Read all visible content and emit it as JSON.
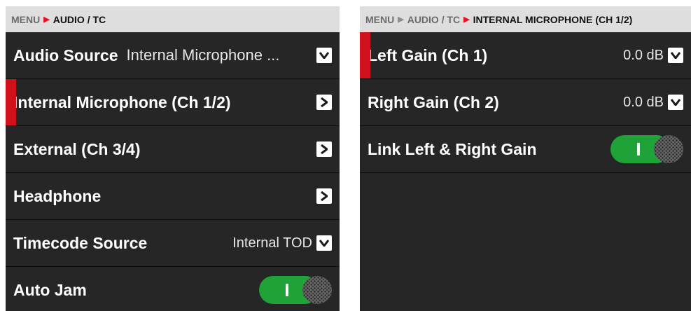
{
  "left_panel": {
    "breadcrumb": {
      "menu": "MENU",
      "current": "AUDIO / TC"
    },
    "rows": [
      {
        "label": "Audio Source",
        "value": "Internal Microphone ..."
      },
      {
        "label": "Internal Microphone (Ch 1/2)"
      },
      {
        "label": "External (Ch 3/4)"
      },
      {
        "label": "Headphone"
      },
      {
        "label": "Timecode Source",
        "value": "Internal TOD"
      },
      {
        "label": "Auto Jam",
        "toggle_on": true
      }
    ],
    "selected_row": "Internal Microphone (Ch 1/2)"
  },
  "right_panel": {
    "breadcrumb": {
      "menu": "MENU",
      "parent": "AUDIO / TC",
      "current": "INTERNAL MICROPHONE (CH 1/2)"
    },
    "rows": [
      {
        "label": "Left Gain (Ch 1)",
        "value": "0.0 dB"
      },
      {
        "label": "Right Gain (Ch 2)",
        "value": "0.0 dB"
      },
      {
        "label": "Link Left & Right Gain",
        "toggle_on": true
      }
    ],
    "selected_row": "Left Gain (Ch 1)"
  },
  "colors": {
    "panel_bg": "#262626",
    "breadcrumb_bg": "#dedede",
    "accent_red": "#d0111c",
    "toggle_on": "#1fa238"
  },
  "icons": {
    "dropdown": "chevron-down-icon",
    "submenu": "chevron-right-icon",
    "breadcrumb_separator": "triangle-right-icon"
  }
}
